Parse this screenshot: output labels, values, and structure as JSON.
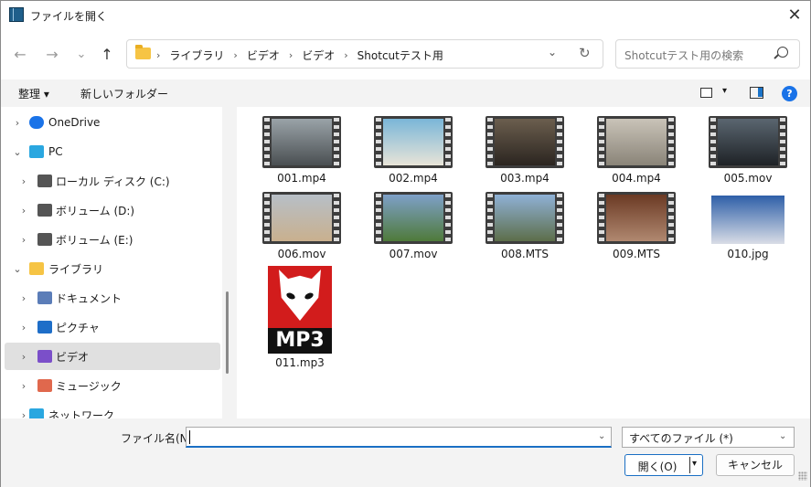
{
  "window": {
    "title": "ファイルを開く",
    "close_glyph": "✕"
  },
  "nav_buttons": {
    "back": "←",
    "forward": "→",
    "recent": "⌄",
    "up": "↑"
  },
  "address": {
    "crumbs": [
      "ライブラリ",
      "ビデオ",
      "ビデオ",
      "Shotcutテスト用"
    ],
    "separator": "›",
    "dropdown_glyph": "⌄",
    "refresh_glyph": "↻"
  },
  "search": {
    "placeholder": "Shotcutテスト用の検索"
  },
  "toolbar": {
    "organize": "整理 ▾",
    "new_folder": "新しいフォルダー",
    "view_dd": "▾",
    "help": "?"
  },
  "sidebar": {
    "items": [
      {
        "label": "OneDrive",
        "chevron": "›",
        "icon": "cloud-icon",
        "color": "#1a73e8"
      },
      {
        "label": "PC",
        "chevron": "⌄",
        "icon": "computer-icon",
        "color": "#2aa7e0"
      },
      {
        "label": "ローカル ディスク (C:)",
        "chevron": "›",
        "icon": "drive-icon",
        "color": "#555555"
      },
      {
        "label": "ボリューム (D:)",
        "chevron": "›",
        "icon": "drive-icon",
        "color": "#555555"
      },
      {
        "label": "ボリューム (E:)",
        "chevron": "›",
        "icon": "drive-icon",
        "color": "#555555"
      },
      {
        "label": "ライブラリ",
        "chevron": "⌄",
        "icon": "library-folder-icon",
        "color": "#f6c444"
      },
      {
        "label": "ドキュメント",
        "chevron": "›",
        "icon": "documents-icon",
        "color": "#5b7db8"
      },
      {
        "label": "ピクチャ",
        "chevron": "›",
        "icon": "pictures-icon",
        "color": "#1e6ec8"
      },
      {
        "label": "ビデオ",
        "chevron": "›",
        "icon": "videos-icon",
        "color": "#7b4fc9"
      },
      {
        "label": "ミュージック",
        "chevron": "›",
        "icon": "music-icon",
        "color": "#e0684d"
      },
      {
        "label": "ネットワーク",
        "chevron": "›",
        "icon": "network-icon",
        "color": "#2aa7e0"
      }
    ]
  },
  "files": [
    {
      "name": "001.mp4",
      "thumb": [
        "#9aa3a8",
        "#4a4f52"
      ]
    },
    {
      "name": "002.mp4",
      "thumb": [
        "#7ab6d8",
        "#e8e4d8"
      ]
    },
    {
      "name": "003.mp4",
      "thumb": [
        "#6b5e4e",
        "#2b2520"
      ]
    },
    {
      "name": "004.mp4",
      "thumb": [
        "#c9c3b8",
        "#8a8478"
      ]
    },
    {
      "name": "005.mov",
      "thumb": [
        "#5a6670",
        "#1e2226"
      ]
    },
    {
      "name": "006.mov",
      "thumb": [
        "#b7bfc7",
        "#c9b08e"
      ]
    },
    {
      "name": "007.mov",
      "thumb": [
        "#7ea0c8",
        "#4f7a3a"
      ]
    },
    {
      "name": "008.MTS",
      "thumb": [
        "#8fb1d6",
        "#5d6e4a"
      ]
    },
    {
      "name": "009.MTS",
      "thumb": [
        "#6b3a24",
        "#b08870"
      ]
    },
    {
      "name": "010.jpg",
      "thumb": [
        "#2e5fa8",
        "#d9dde6"
      ]
    }
  ],
  "mp3_file": {
    "name": "011.mp3",
    "badge": "MP3"
  },
  "bottom": {
    "filename_label": "ファイル名(N):",
    "filename_value": "",
    "filter_value": "すべてのファイル (*)",
    "dd_glyph": "⌄",
    "open_label": "開く(O)",
    "open_dd": "▾",
    "cancel_label": "キャンセル"
  }
}
